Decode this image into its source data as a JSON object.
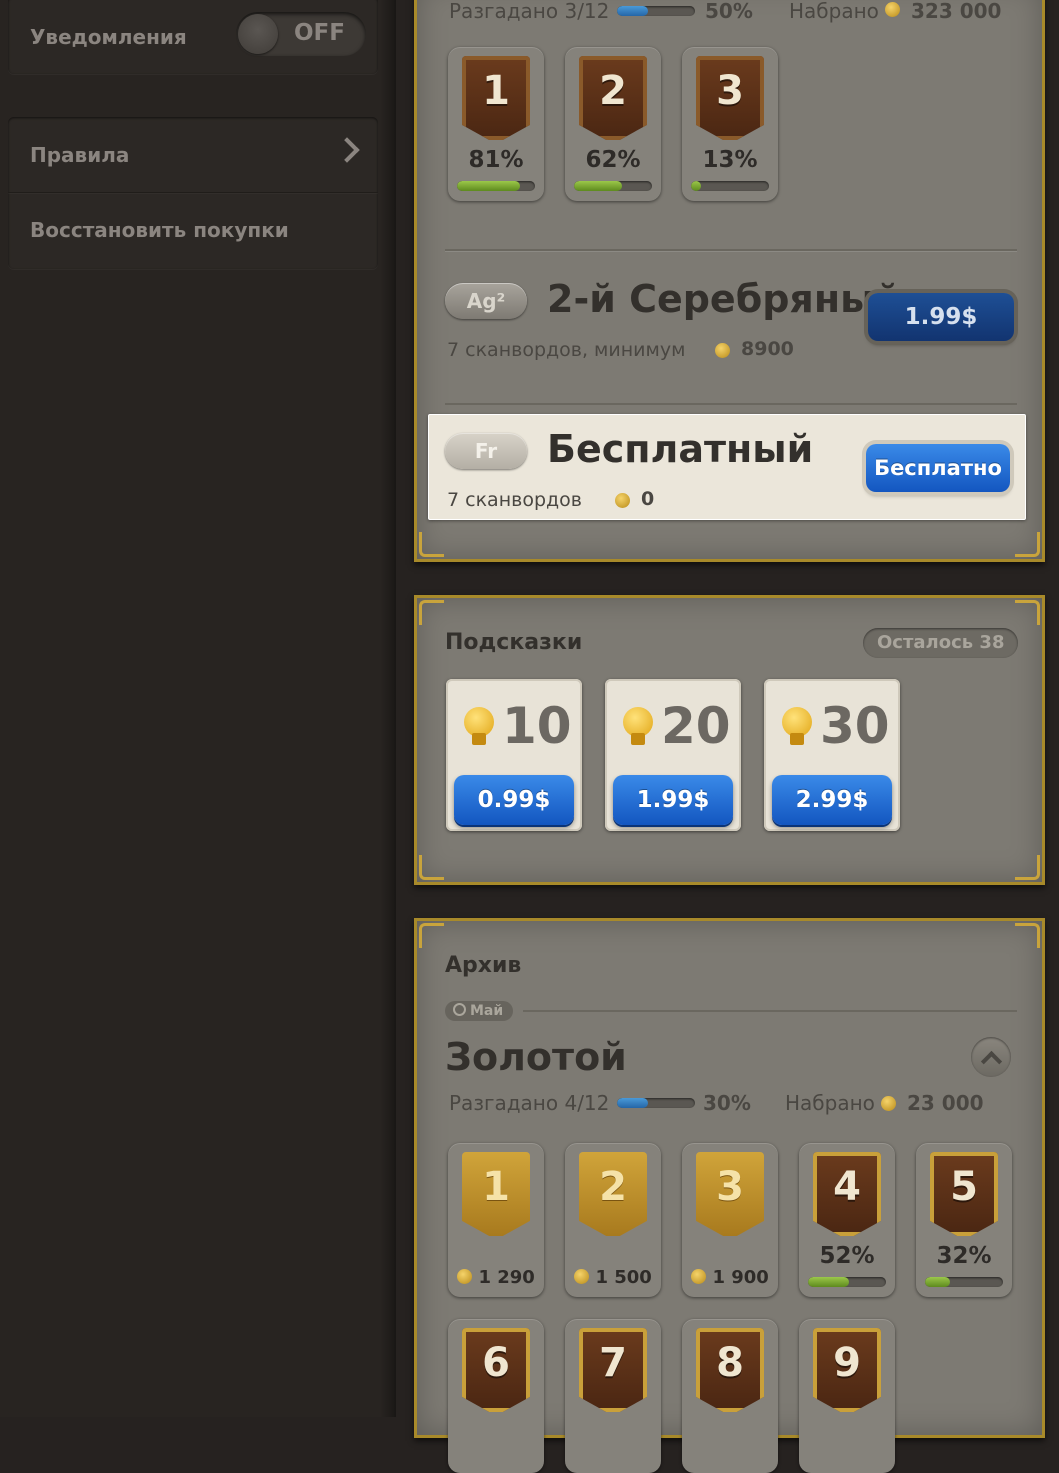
{
  "sidebar": {
    "notifications_label": "Уведомления",
    "notifications_toggle": "OFF",
    "rules_label": "Правила",
    "restore_label": "Восстановить покупки"
  },
  "current": {
    "solved_label": "Разгадано 3/12",
    "solved_progress": 0.4,
    "percent": "50%",
    "score_label": "Набрано",
    "score": "323 000",
    "levels": [
      {
        "num": "1",
        "pct": "81%",
        "progress": 0.81
      },
      {
        "num": "2",
        "pct": "62%",
        "progress": 0.62
      },
      {
        "num": "3",
        "pct": "13%",
        "progress": 0.13
      }
    ],
    "silver": {
      "plaque": "Ag²",
      "title": "2-й Серебряный",
      "desc": "7 сканвордов, минимум",
      "coins": "8900",
      "price": "1.99$"
    },
    "free": {
      "plaque": "Fr",
      "title": "Бесплатный",
      "desc": "7 сканвордов",
      "coins": "0",
      "button": "Бесплатно"
    }
  },
  "hints": {
    "title": "Подсказки",
    "remaining": "Осталось 38",
    "packs": [
      {
        "qty": "10",
        "price": "0.99$"
      },
      {
        "qty": "20",
        "price": "1.99$"
      },
      {
        "qty": "30",
        "price": "2.99$"
      }
    ]
  },
  "archive": {
    "title": "Архив",
    "month": "Май",
    "section_title": "Золотой",
    "solved_label": "Разгадано 4/12",
    "solved_progress": 0.4,
    "percent": "30%",
    "score_label": "Набрано",
    "score": "23 000",
    "levels_row1": [
      {
        "num": "1",
        "coins": "1 290"
      },
      {
        "num": "2",
        "coins": "1 500"
      },
      {
        "num": "3",
        "coins": "1 900"
      },
      {
        "num": "4",
        "pct": "52%",
        "progress": 0.52
      },
      {
        "num": "5",
        "pct": "32%",
        "progress": 0.32
      }
    ],
    "levels_row2": [
      "6",
      "7",
      "8",
      "9"
    ]
  },
  "colors": {
    "accent_blue": "#1e62c8",
    "frame_gold": "#a88a2a",
    "progress_green": "#6e9a2a",
    "progress_blue": "#2f78c2"
  }
}
